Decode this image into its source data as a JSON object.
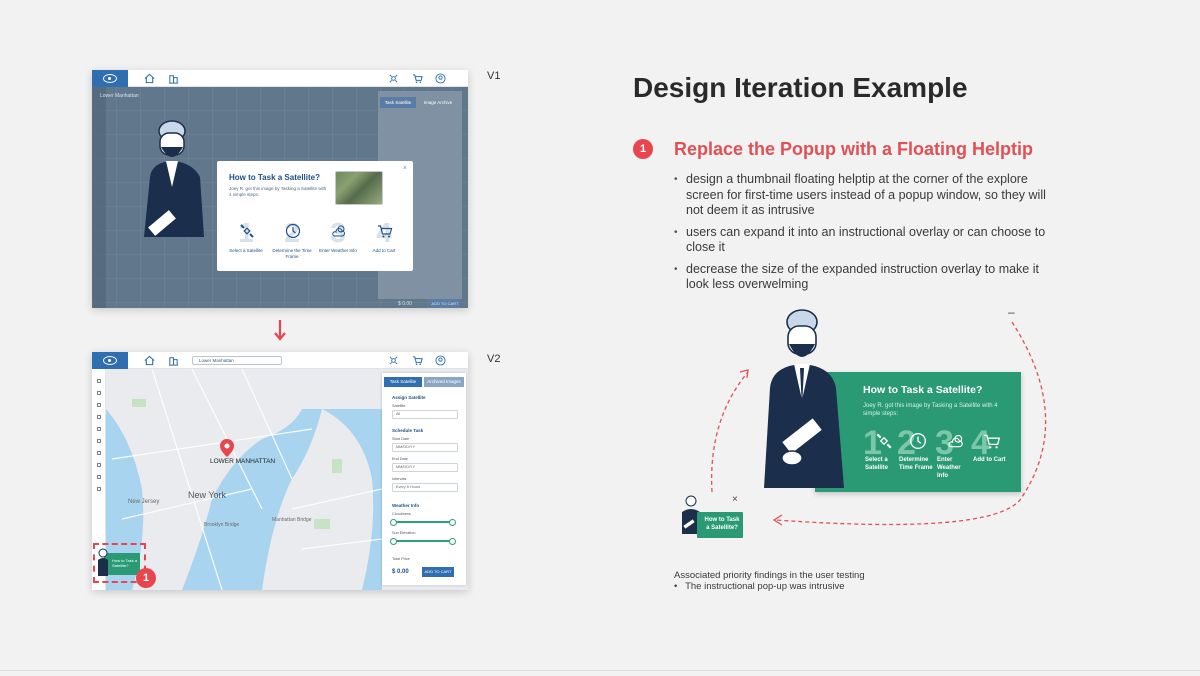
{
  "heading": "Design Iteration Example",
  "section": {
    "number": "1",
    "title": "Replace the Popup with a Floating Helptip",
    "bullets": [
      "design a thumbnail floating helptip at the corner of the explore screen for first-time users instead of a popup window, so they will not deem it as intrusive",
      "users can expand it into an instructional overlay or can choose to close it",
      "decrease the size of the expanded instruction overlay to make it look less overwelming"
    ]
  },
  "versions": {
    "v1": "V1",
    "v2": "V2"
  },
  "v1": {
    "search": "Lower Manhattan",
    "tabs": [
      "Task Satellite",
      "Image Archive"
    ],
    "popup": {
      "title": "How to Task a Satellite?",
      "subtitle": "Joey R. got this image by Tasking a Satellite with 4 simple steps:",
      "close": "×",
      "steps": [
        {
          "num": "1",
          "icon": "satellite-icon",
          "label": "Select a Satellite"
        },
        {
          "num": "2",
          "icon": "clock-icon",
          "label": "Determine the Time Frame"
        },
        {
          "num": "3",
          "icon": "weather-icon",
          "label": "Enter Weather Info"
        },
        {
          "num": "4",
          "icon": "cart-icon",
          "label": "Add to Cart"
        }
      ]
    },
    "price": "$ 0.00",
    "cta": "ADD TO CART"
  },
  "v2": {
    "search": "Lower Manhattan",
    "tabs": [
      "Task Satellite",
      "Archived Images"
    ],
    "panel": {
      "assign": "Assign Satellite",
      "satellite_label": "Satellite",
      "satellite_value": "All",
      "schedule": "Schedule Task",
      "start_label": "Start Date",
      "start_value": "MM/DD/YY",
      "end_label": "End Date",
      "end_value": "MM/DD/YY",
      "interval_label": "Intervals",
      "interval_value": "Every 8 Hours",
      "weather": "Weather Info",
      "cloud_label": "Cloudiness",
      "sun_label": "Sun Elevation",
      "price_label": "Total Price",
      "price": "$ 0.00",
      "cta": "ADD TO CART"
    },
    "map": {
      "lower_manhattan": "LOWER MANHATTAN",
      "new_york": "New York",
      "new_jersey": "New Jersey",
      "brooklyn_bridge": "Brooklyn Bridge",
      "manhattan_bridge": "Manhattan Bridge"
    },
    "mini_tip": "How to Task a Satellite?",
    "badge": "1"
  },
  "expanded_tip": {
    "title": "How to Task a Satellite?",
    "subtitle": "Joey R. got this image by Tasking a Satellite with 4 simple steps:",
    "steps": [
      {
        "num": "1",
        "icon": "satellite-icon",
        "label": "Select a Satellite"
      },
      {
        "num": "2",
        "icon": "clock-icon",
        "label": "Determine Time Frame"
      },
      {
        "num": "3",
        "icon": "weather-icon",
        "label": "Enter Weather Info"
      },
      {
        "num": "4",
        "icon": "cart-icon",
        "label": "Add to Cart"
      }
    ],
    "minimize": "–"
  },
  "thumbnail_tip": {
    "label": "How to Task a Satellite?",
    "close": "×"
  },
  "findings": {
    "title": "Associated priority findings in the user testing",
    "items": [
      "The instructional pop-up was intrusive"
    ]
  },
  "colors": {
    "accent_red": "#e8464e",
    "brand_blue": "#2f6fb1",
    "helptip_green": "#2a9a74"
  }
}
